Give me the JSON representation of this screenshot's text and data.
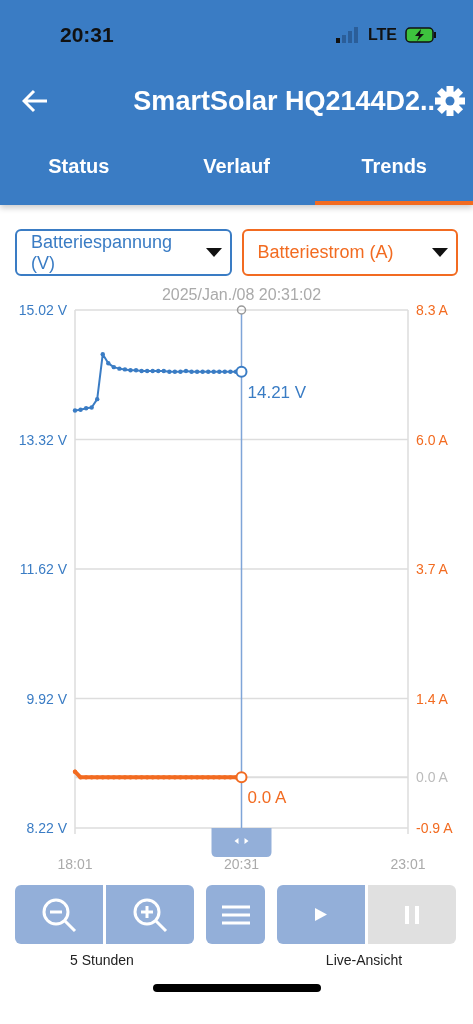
{
  "status_bar": {
    "time": "20:31",
    "network": "LTE"
  },
  "header": {
    "title": "SmartSolar HQ2144D2.."
  },
  "tabs": [
    {
      "label": "Status",
      "selected": false
    },
    {
      "label": "Verlauf",
      "selected": false
    },
    {
      "label": "Trends",
      "selected": true
    }
  ],
  "selectors": [
    {
      "label": "Batteriespannung (V)",
      "color": "#3a7cc4"
    },
    {
      "label": "Batteriestrom (A)",
      "color": "#f26b21"
    }
  ],
  "chart": {
    "timestamp": "2025/Jan./08 20:31:02",
    "readings": [
      {
        "text": "14.21 V",
        "color": "#3a7cc4"
      },
      {
        "text": "0.0 A",
        "color": "#f26b21"
      }
    ],
    "chart_data": {
      "type": "line",
      "grid": true,
      "categories": [
        "18:01",
        null,
        null,
        null,
        null,
        null,
        null,
        null,
        null,
        null,
        null,
        null,
        null,
        null,
        null,
        null,
        null,
        null,
        null,
        null,
        null,
        null,
        null,
        null,
        null,
        null,
        null,
        null,
        null,
        null,
        "20:31",
        null,
        null,
        null,
        null,
        null,
        null,
        null,
        null,
        null,
        null,
        null,
        null,
        null,
        null,
        null,
        null,
        null,
        null,
        null,
        null,
        null,
        null,
        null,
        null,
        null,
        null,
        null,
        null,
        null,
        "23:01"
      ],
      "ylim": [
        8.22,
        15.02
      ],
      "yticks": [
        {
          "value": 15.02,
          "label": "15.02 V"
        },
        {
          "value": 13.32,
          "label": "13.32 V"
        },
        {
          "value": 11.62,
          "label": "11.62 V"
        },
        {
          "value": 9.92,
          "label": "9.92 V"
        },
        {
          "value": 8.22,
          "label": "8.22 V"
        }
      ],
      "y2lim": [
        -0.9,
        8.3
      ],
      "y2ticks": [
        {
          "value": 8.3,
          "label": "8.3 A"
        },
        {
          "value": 6.0,
          "label": "6.0 A"
        },
        {
          "value": 3.7,
          "label": "3.7 A"
        },
        {
          "value": 1.4,
          "label": "1.4 A"
        },
        {
          "value": 0.0,
          "label": "0.0 A"
        },
        {
          "value": -0.9,
          "label": "-0.9 A"
        }
      ],
      "series": [
        {
          "color": "#3a7cc4",
          "values": [
            13.7,
            13.71,
            13.73,
            13.74,
            13.85,
            14.44,
            14.32,
            14.27,
            14.25,
            14.24,
            14.23,
            14.23,
            14.22,
            14.22,
            14.22,
            14.22,
            14.22,
            14.21,
            14.21,
            14.21,
            14.22,
            14.21,
            14.21,
            14.21,
            14.21,
            14.21,
            14.21,
            14.21,
            14.21,
            14.21,
            14.21,
            null,
            null,
            null,
            null,
            null,
            null,
            null,
            null,
            null,
            null,
            null,
            null,
            null,
            null,
            null,
            null,
            null,
            null,
            null,
            null,
            null,
            null,
            null,
            null,
            null,
            null,
            null,
            null,
            null,
            null
          ]
        },
        {
          "color": "#f26b21",
          "axis": "y2",
          "values": [
            0.1,
            0.0,
            0.0,
            0.0,
            0.0,
            0.0,
            0.0,
            0.0,
            0.0,
            0.0,
            0.0,
            0.0,
            0.0,
            0.0,
            0.0,
            0.0,
            0.0,
            0.0,
            0.0,
            0.0,
            0.0,
            0.0,
            0.0,
            0.0,
            0.0,
            0.0,
            0.0,
            0.0,
            0.0,
            0.0,
            0.0,
            null,
            null,
            null,
            null,
            null,
            null,
            null,
            null,
            null,
            null,
            null,
            null,
            null,
            null,
            null,
            null,
            null,
            null,
            null,
            null,
            null,
            null,
            null,
            null,
            null,
            null,
            null,
            null,
            null,
            null
          ]
        }
      ]
    }
  },
  "controls": {
    "buttons": [
      {
        "kind": "zoom-out",
        "disabled": false
      },
      {
        "kind": "zoom-in",
        "disabled": false
      },
      {
        "kind": "menu",
        "disabled": false
      },
      {
        "kind": "play",
        "disabled": false
      },
      {
        "kind": "pause",
        "disabled": true
      }
    ],
    "zoom_label": "5 Stunden",
    "live_label": "Live-Ansicht"
  }
}
